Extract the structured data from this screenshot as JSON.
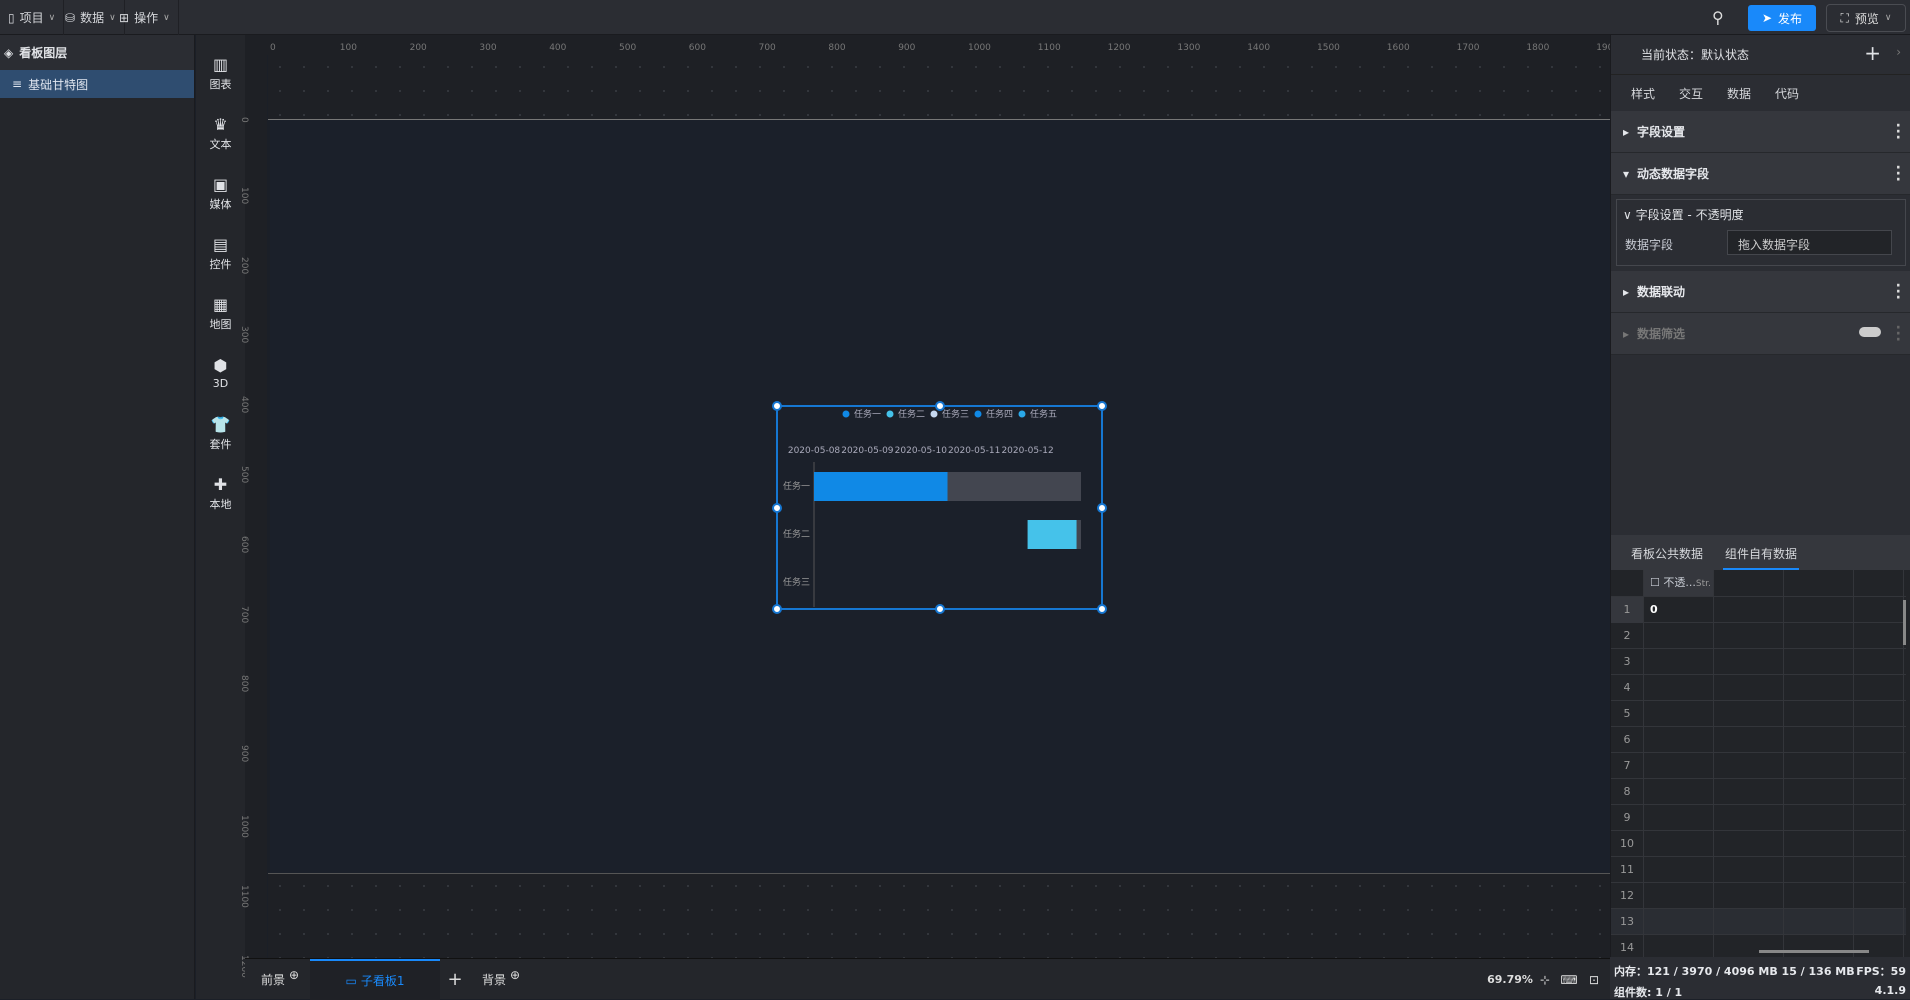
{
  "topbar": {
    "menus": [
      {
        "label": "项目",
        "icon": "file-icon"
      },
      {
        "label": "数据",
        "icon": "database-icon"
      },
      {
        "label": "操作",
        "icon": "grid-icon"
      }
    ],
    "publish": "发布",
    "preview": "预览"
  },
  "layers": {
    "title": "看板图层",
    "items": [
      {
        "label": "基础甘特图"
      }
    ]
  },
  "tools": [
    {
      "label": "图表",
      "icon": "chart-icon"
    },
    {
      "label": "文本",
      "icon": "text-icon"
    },
    {
      "label": "媒体",
      "icon": "media-icon"
    },
    {
      "label": "控件",
      "icon": "control-icon"
    },
    {
      "label": "地图",
      "icon": "map-icon"
    },
    {
      "label": "3D",
      "icon": "cube-icon"
    },
    {
      "label": "套件",
      "icon": "suite-icon"
    },
    {
      "label": "本地",
      "icon": "puzzle-icon"
    }
  ],
  "ruler": {
    "h": [
      "0",
      "100",
      "200",
      "300",
      "400",
      "500",
      "600",
      "700",
      "800",
      "900",
      "1000",
      "1100",
      "1200",
      "1300",
      "1400",
      "1500",
      "1600",
      "1700",
      "1800",
      "1900"
    ],
    "v": [
      "0",
      "100",
      "200",
      "300",
      "400",
      "500",
      "600",
      "700",
      "800",
      "900",
      "1000",
      "1100",
      "1200"
    ]
  },
  "chart_data": {
    "type": "gantt",
    "legend": [
      "任务一",
      "任务二",
      "任务三",
      "任务四",
      "任务五"
    ],
    "legend_colors": [
      "#1089e6",
      "#45c2ea",
      "#c6d8f0",
      "#1089e6",
      "#2aa8e8"
    ],
    "legend_position": "top-right",
    "x_ticks": [
      "2020-05-08",
      "2020-05-09",
      "2020-05-10",
      "2020-05-11",
      "2020-05-12"
    ],
    "xlim": [
      "2020-05-08",
      "2020-05-13"
    ],
    "categories": [
      "任务一",
      "任务二",
      "任务三"
    ],
    "tasks": [
      {
        "name": "任务一",
        "start": "2020-05-08 00:00",
        "end": "2020-05-10 12:00",
        "color": "#1089e6"
      },
      {
        "name": "任务二",
        "start": "2020-05-12 00:00",
        "end": "2020-05-12 22:00",
        "color": "#45c2ea"
      }
    ],
    "track_color": "#434650"
  },
  "bottom": {
    "foreground": "前景",
    "subboard": "子看板1",
    "background": "背景",
    "zoom": "69.79%"
  },
  "right": {
    "state": "当前状态：默认状态",
    "tabs": [
      "样式",
      "交互",
      "数据",
      "代码"
    ],
    "active_tab": "数据",
    "sections": {
      "field_settings": "字段设置",
      "dynamic": "动态数据字段",
      "sub_title": "字段设置 - 不透明度",
      "data_field_label": "数据字段",
      "data_field_placeholder": "拖入数据字段",
      "linkage": "数据联动",
      "filter": "数据筛选"
    },
    "data_tabs": [
      "看板公共数据",
      "组件自有数据"
    ],
    "column": "不透...",
    "column_type": "Str.",
    "rows": [
      "1",
      "2",
      "3",
      "4",
      "5",
      "6",
      "7",
      "8",
      "9",
      "10",
      "11",
      "12",
      "13",
      "14"
    ],
    "cell": "0"
  },
  "status": {
    "memory": "内存：121 / 3970 / 4096 MB 15 / 136 MB",
    "fps": "FPS：59",
    "count": "组件数: 1 / 1",
    "version": "4.1.9"
  }
}
